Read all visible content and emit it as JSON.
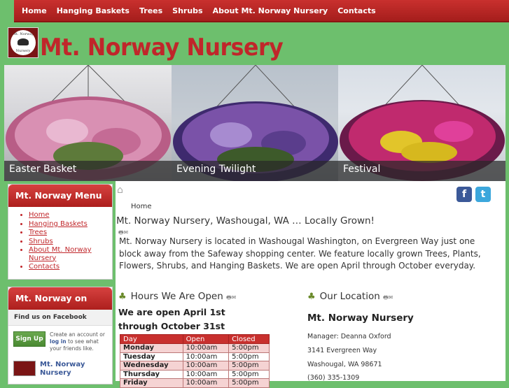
{
  "nav": [
    "Home",
    "Hanging Baskets",
    "Trees",
    "Shrubs",
    "About Mt. Norway Nursery",
    "Contacts"
  ],
  "logo": {
    "line1": "Mt. Norway",
    "line2": "Nursery"
  },
  "site_title": "Mt. Norway Nursery",
  "banner": [
    "Easter Basket",
    "Evening Twilight",
    "Festival"
  ],
  "sidebar": {
    "menu_title": "Mt. Norway Menu",
    "menu_items": [
      "Home",
      "Hanging Baskets",
      "Trees",
      "Shrubs",
      "About Mt. Norway Nursery",
      "Contacts"
    ],
    "fb_box_title": "Mt. Norway on",
    "fb_find": "Find us on Facebook",
    "fb_signup": "Sign Up",
    "fb_text_a": "Create an account or",
    "fb_login": "log in",
    "fb_text_b": "to see what your friends like.",
    "fb_page_name": "Mt. Norway Nursery"
  },
  "breadcrumb": "Home",
  "social": {
    "facebook": "f",
    "twitter": "t"
  },
  "article": {
    "title": "Mt. Norway Nursery, Washougal, WA … Locally Grown!",
    "body": "Mt. Norway Nursery is located in Washougal Washington, on Evergreen Way just one block away from the Safeway shopping center. We feature locally grown Trees, Plants, Flowers, Shrubs, and Hanging Baskets. We are open April through October everyday."
  },
  "hours": {
    "title": "Hours We Are Open",
    "line1": "We are open April 1st",
    "line2": "through October 31st",
    "headers": [
      "Day",
      "Open",
      "Closed"
    ],
    "rows": [
      [
        "Monday",
        "10:00am",
        "5:00pm"
      ],
      [
        "Tuesday",
        "10:00am",
        "5:00pm"
      ],
      [
        "Wednesday",
        "10:00am",
        "5:00pm"
      ],
      [
        "Thursday",
        "10:00am",
        "5:00pm"
      ],
      [
        "Friday",
        "10:00am",
        "5:00pm"
      ]
    ]
  },
  "location": {
    "title": "Our Location",
    "name": "Mt. Norway Nursery",
    "manager": "Manager: Deanna Oxford",
    "street": "3141 Evergreen Way",
    "city": "Washougal, WA 98671",
    "phone": "(360) 335-1309"
  },
  "colors": {
    "brand_red": "#c0262a",
    "page_green": "#6dbf6d"
  }
}
